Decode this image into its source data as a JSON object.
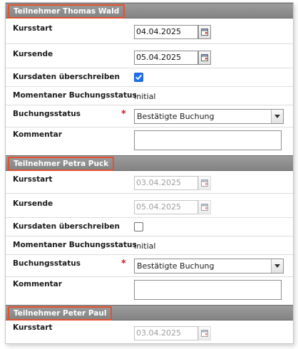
{
  "labels": {
    "start": "Kursstart",
    "end": "Kursende",
    "override": "Kursdaten überschreiben",
    "current_status": "Momentaner Buchungsstatus",
    "status": "Buchungsstatus",
    "comment": "Kommentar",
    "required_marker": "*"
  },
  "participants": [
    {
      "title": "Teilnehmer Thomas Wald",
      "start": "04.04.2025",
      "end": "05.04.2025",
      "override_checked": true,
      "current_status": "Initial",
      "status": "Bestätigte Buchung",
      "comment": ""
    },
    {
      "title": "Teilnehmer Petra Puck",
      "start": "03.04.2025",
      "end": "05.04.2025",
      "override_checked": false,
      "current_status": "Initial",
      "status": "Bestätigte Buchung",
      "comment": ""
    },
    {
      "title": "Teilnehmer Peter Paul",
      "start": "03.04.2025"
    }
  ],
  "colors": {
    "header_bg": "#8f8f8f",
    "highlight_border": "#e4502c",
    "checkbox_checked": "#1f6ff2",
    "required": "#d41b1b"
  }
}
